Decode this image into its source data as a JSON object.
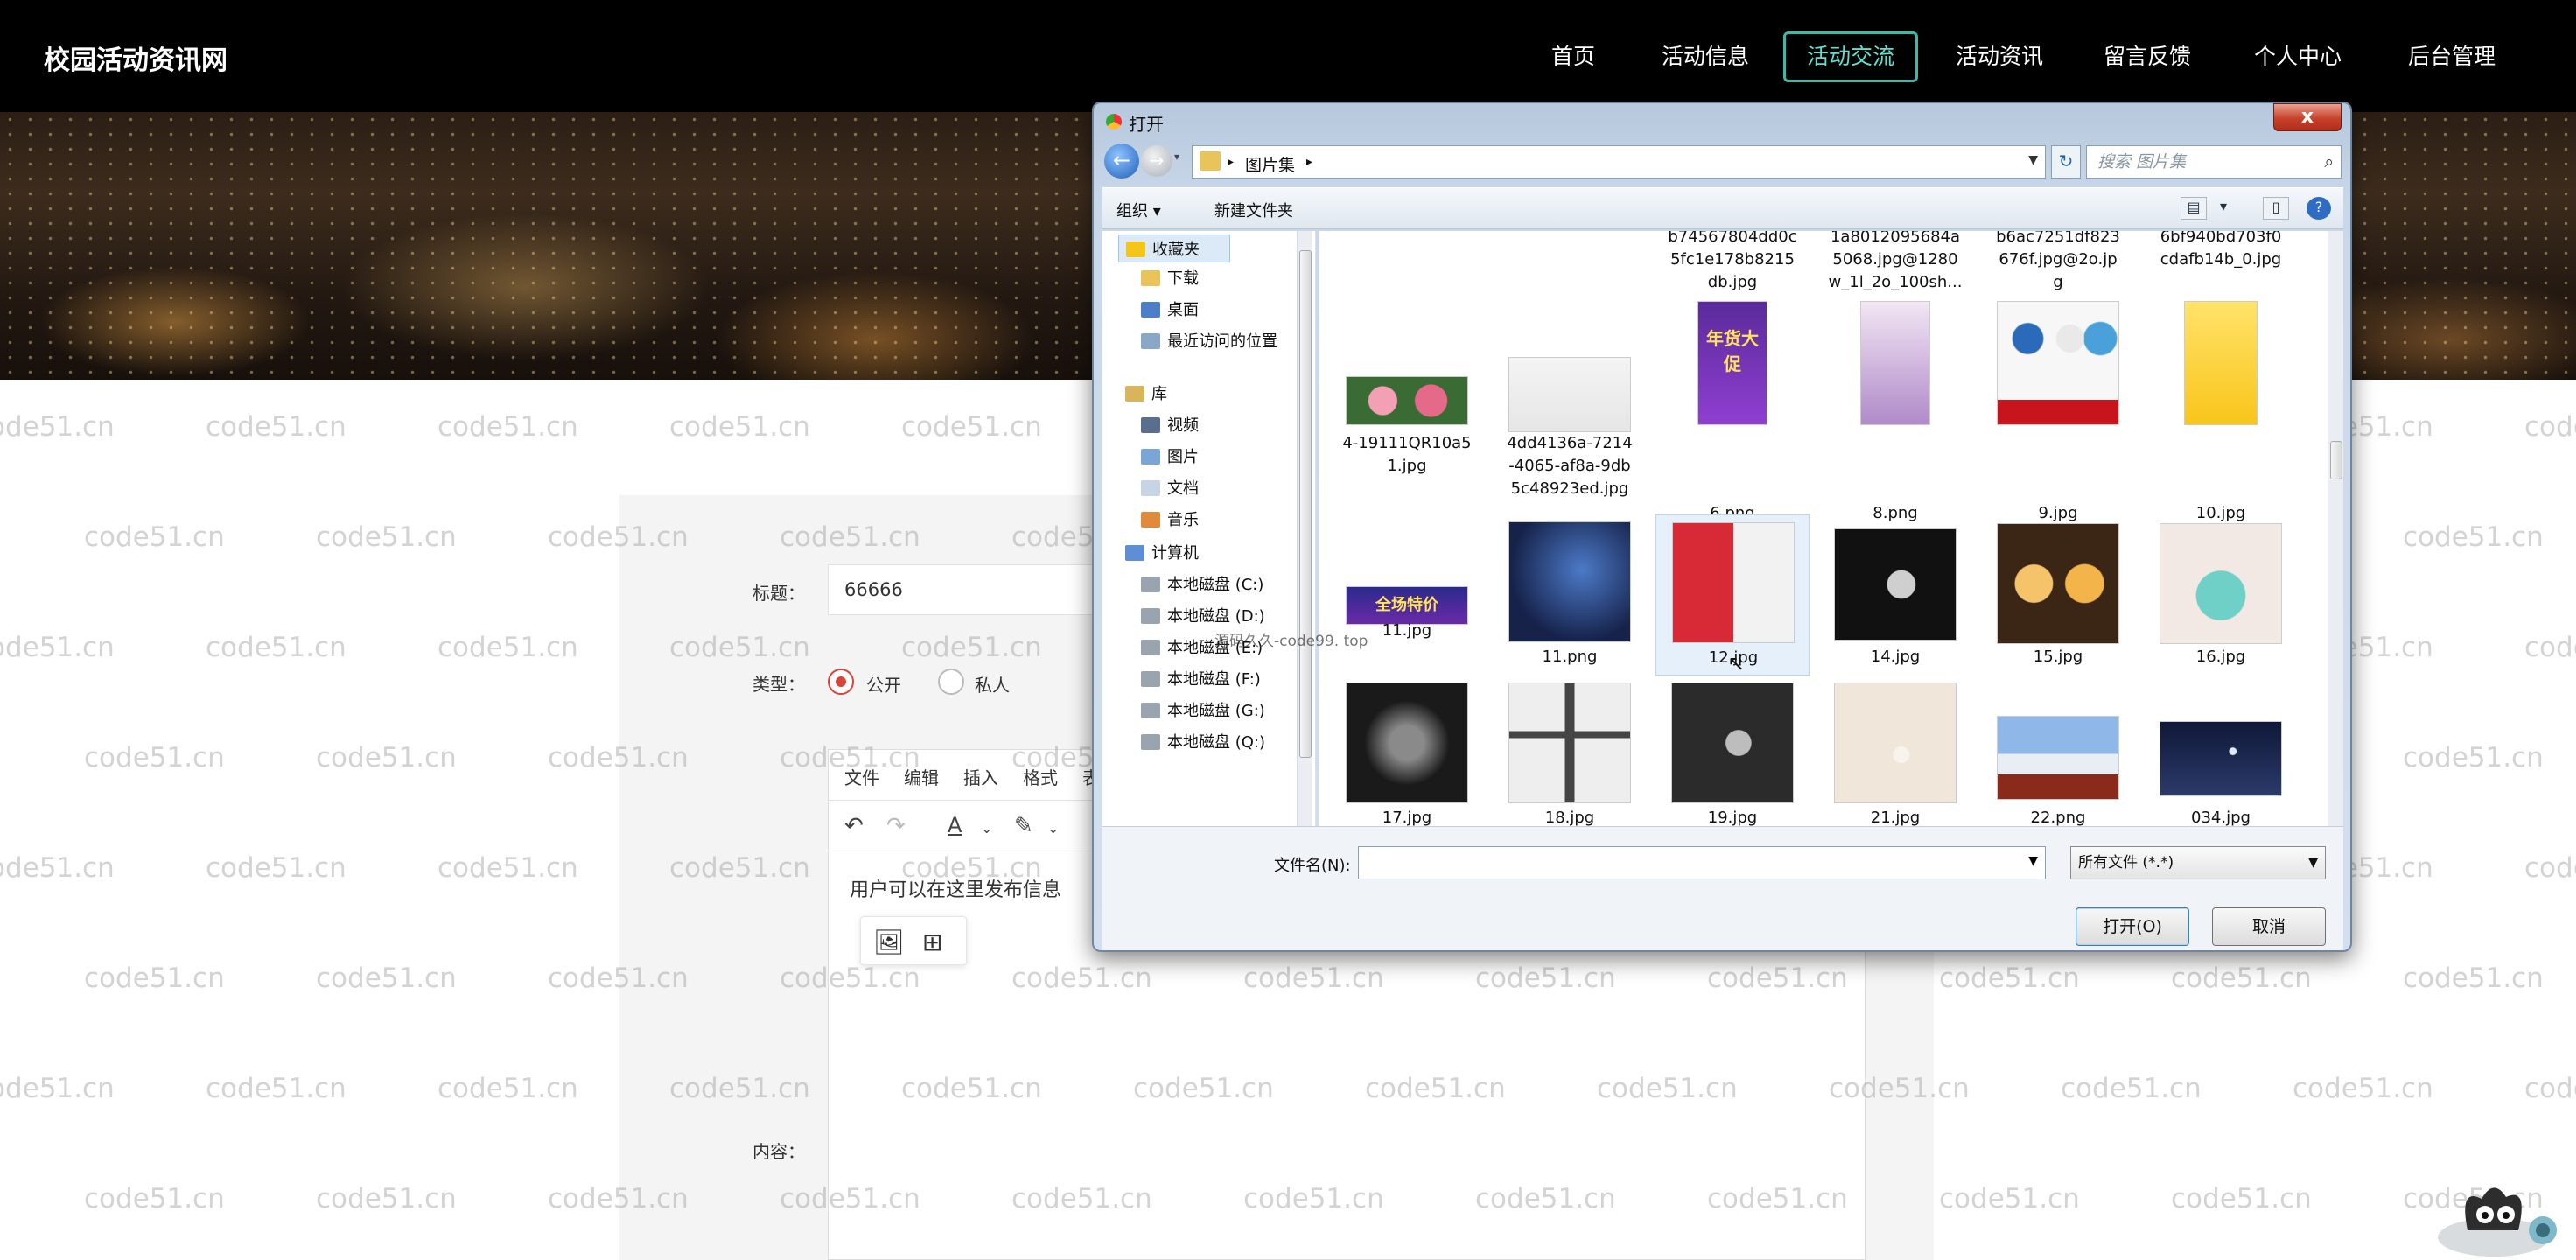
{
  "site": {
    "title": "校园活动资讯网",
    "nav": [
      {
        "label": "首页",
        "active": false
      },
      {
        "label": "活动信息",
        "active": false
      },
      {
        "label": "活动交流",
        "active": true
      },
      {
        "label": "活动资讯",
        "active": false
      },
      {
        "label": "留言反馈",
        "active": false
      },
      {
        "label": "个人中心",
        "active": false
      },
      {
        "label": "后台管理",
        "active": false
      }
    ]
  },
  "form": {
    "title_label": "标题：",
    "title_value": "66666",
    "type_label": "类型：",
    "type_options": [
      "公开",
      "私人"
    ],
    "type_selected": "公开",
    "content_label": "内容：",
    "editor_menu": [
      "文件",
      "编辑",
      "插入",
      "格式",
      "表"
    ],
    "editor_placeholder": "用户可以在这里发布信息"
  },
  "watermark": "code51.cn",
  "overlay_watermark": "源码久久-code99. top",
  "dialog": {
    "title": "打开",
    "close_label": "x",
    "path": [
      "图片集"
    ],
    "search_placeholder": "搜索 图片集",
    "toolbar": {
      "organize": "组织 ▾",
      "new_folder": "新建文件夹"
    },
    "nav_tree": [
      {
        "label": "收藏夹",
        "group": true,
        "icon": "star-icon"
      },
      {
        "label": "下载",
        "icon": "folder-icon"
      },
      {
        "label": "桌面",
        "icon": "desktop-icon"
      },
      {
        "label": "最近访问的位置",
        "icon": "recent-icon"
      },
      {
        "label": "库",
        "group": true,
        "icon": "library-icon"
      },
      {
        "label": "视频",
        "icon": "video-icon"
      },
      {
        "label": "图片",
        "icon": "picture-icon"
      },
      {
        "label": "文档",
        "icon": "document-icon"
      },
      {
        "label": "音乐",
        "icon": "music-icon"
      },
      {
        "label": "计算机",
        "group": true,
        "icon": "computer-icon"
      },
      {
        "label": "本地磁盘 (C:)",
        "icon": "drive-icon"
      },
      {
        "label": "本地磁盘 (D:)",
        "icon": "drive-icon"
      },
      {
        "label": "本地磁盘 (E:)",
        "icon": "drive-icon"
      },
      {
        "label": "本地磁盘 (F:)",
        "icon": "drive-icon"
      },
      {
        "label": "本地磁盘 (G:)",
        "icon": "drive-icon"
      },
      {
        "label": "本地磁盘 (Q:)",
        "icon": "drive-icon"
      }
    ],
    "files": [
      {
        "name": "b74567804dd0c\n5fc1e178b8215\ndb.jpg"
      },
      {
        "name": "1a8012095684a\n5068.jpg@1280\nw_1l_2o_100sh..."
      },
      {
        "name": "b6ac7251df823\n676f.jpg@2o.jp\ng"
      },
      {
        "name": "6bf940bd703f0\ncdafb14b_0.jpg"
      },
      {
        "name": "4-19111QR10a5\n1.jpg"
      },
      {
        "name": "4dd4136a-7214\n-4065-af8a-9db\n5c48923ed.jpg"
      },
      {
        "name": "6.png"
      },
      {
        "name": "8.png"
      },
      {
        "name": "9.jpg"
      },
      {
        "name": "10.jpg"
      },
      {
        "name": "11.jpg"
      },
      {
        "name": "11.png"
      },
      {
        "name": "12.jpg"
      },
      {
        "name": "14.jpg"
      },
      {
        "name": "15.jpg"
      },
      {
        "name": "16.jpg"
      },
      {
        "name": "17.jpg"
      },
      {
        "name": "18.jpg"
      },
      {
        "name": "19.jpg"
      },
      {
        "name": "21.jpg"
      },
      {
        "name": "22.png"
      },
      {
        "name": "034.jpg"
      }
    ],
    "thumb_texts": {
      "sale": "全场特价",
      "flyer": "年货大促"
    },
    "filename_label": "文件名(N):",
    "filename_value": "",
    "filter": "所有文件 (*.*)",
    "open_button": "打开(O)",
    "cancel_button": "取消"
  },
  "colors": {
    "accent": "#3fb8a8",
    "radio_on": "#d8443a"
  }
}
